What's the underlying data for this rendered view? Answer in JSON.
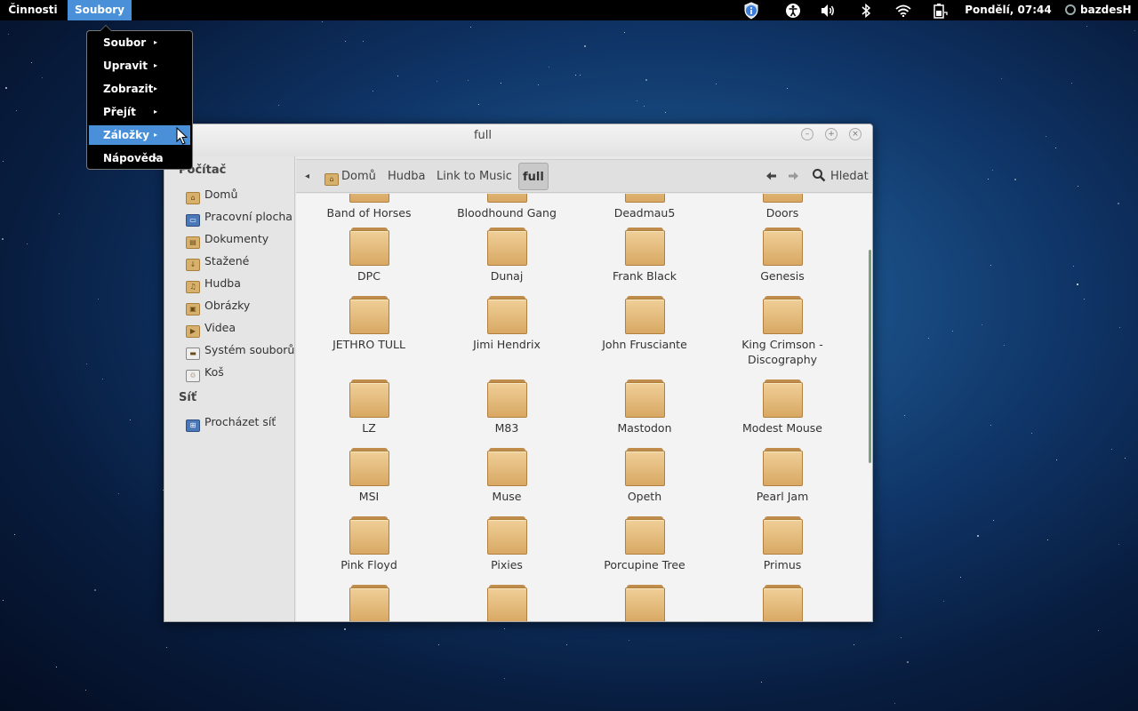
{
  "topbar": {
    "activities": "Činnosti",
    "app_menu": "Soubory",
    "clock": "Pondělí, 07:44",
    "user": "bazdesH",
    "tray_icons": [
      "shield-icon",
      "accessibility-icon",
      "volume-icon",
      "bluetooth-icon",
      "wifi-icon",
      "battery-icon"
    ]
  },
  "app_menu_items": [
    {
      "label": "Soubor",
      "arrow": "▸"
    },
    {
      "label": "Upravit",
      "arrow": "▸"
    },
    {
      "label": "Zobrazit",
      "arrow": "▸"
    },
    {
      "label": "Přejít",
      "arrow": "▸"
    },
    {
      "label": "Záložky",
      "arrow": "▸",
      "active": true
    },
    {
      "label": "Nápověda",
      "arrow": "▸"
    }
  ],
  "window": {
    "title": "full",
    "buttons": [
      "minimize",
      "maximize",
      "close"
    ]
  },
  "sidebar": {
    "computer_heading": "Počítač",
    "items": [
      {
        "label": "Domů",
        "icon": "home-folder-icon"
      },
      {
        "label": "Pracovní plocha",
        "icon": "desktop-icon"
      },
      {
        "label": "Dokumenty",
        "icon": "documents-folder-icon"
      },
      {
        "label": "Stažené",
        "icon": "downloads-folder-icon"
      },
      {
        "label": "Hudba",
        "icon": "music-folder-icon"
      },
      {
        "label": "Obrázky",
        "icon": "pictures-folder-icon"
      },
      {
        "label": "Videa",
        "icon": "videos-folder-icon"
      },
      {
        "label": "Systém souborů",
        "icon": "drive-icon"
      },
      {
        "label": "Koš",
        "icon": "trash-icon"
      }
    ],
    "network_heading": "Síť",
    "network_items": [
      {
        "label": "Procházet síť",
        "icon": "network-icon"
      }
    ]
  },
  "toolbar": {
    "back_crumb": "◂",
    "crumbs": [
      "Domů",
      "Hudba",
      "Link to Music",
      "full"
    ],
    "back": "🡐",
    "forward": "🡒",
    "search": "Hledat"
  },
  "folders": [
    [
      "Band of Horses",
      "Bloodhound Gang",
      "Deadmau5",
      "Doors"
    ],
    [
      "DPC",
      "Dunaj",
      "Frank Black",
      "Genesis"
    ],
    [
      "JETHRO TULL",
      "Jimi Hendrix",
      "John Frusciante",
      "King Crimson - Discography"
    ],
    [
      "LZ",
      "M83",
      "Mastodon",
      "Modest Mouse"
    ],
    [
      "MSI",
      "Muse",
      "Opeth",
      "Pearl Jam"
    ],
    [
      "Pink Floyd",
      "Pixies",
      "Porcupine Tree",
      "Primus"
    ],
    [
      "",
      "",
      "",
      ""
    ]
  ]
}
